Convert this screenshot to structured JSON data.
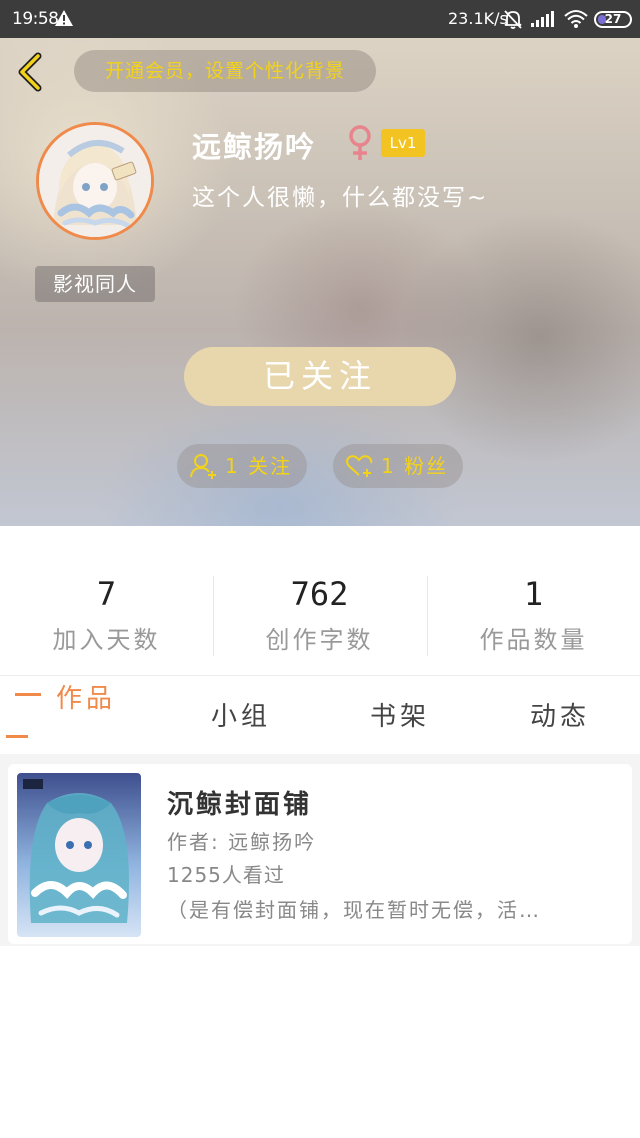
{
  "status_bar": {
    "time": "19:58",
    "net_speed": "23.1K/s",
    "battery": "27",
    "battery_level": 0.27
  },
  "header": {
    "vip_banner": "开通会员，设置个性化背景",
    "username": "远鲸扬吟",
    "level": "Lv1",
    "bio": "这个人很懒，什么都没写~",
    "tag": "影视同人",
    "follow_button": "已关注",
    "following_label": "1 关注",
    "fans_label": "1 粉丝"
  },
  "stats": [
    {
      "value": "7",
      "label": "加入天数"
    },
    {
      "value": "762",
      "label": "创作字数"
    },
    {
      "value": "1",
      "label": "作品数量"
    }
  ],
  "tabs": [
    {
      "label": "作品",
      "active": true
    },
    {
      "label": "小组",
      "active": false
    },
    {
      "label": "书架",
      "active": false
    },
    {
      "label": "动态",
      "active": false
    }
  ],
  "works": [
    {
      "title": "沉鲸封面铺",
      "author": "作者: 远鲸扬吟",
      "views": "1255人看过",
      "description": "（是有偿封面铺，现在暂时无偿，活…"
    }
  ],
  "colors": {
    "accent": "#f08a4b",
    "vip_text": "#f3d21a",
    "level_badge": "#f3c321",
    "follow_button": "#e8d7ad",
    "gender_icon": "#e8848d"
  }
}
